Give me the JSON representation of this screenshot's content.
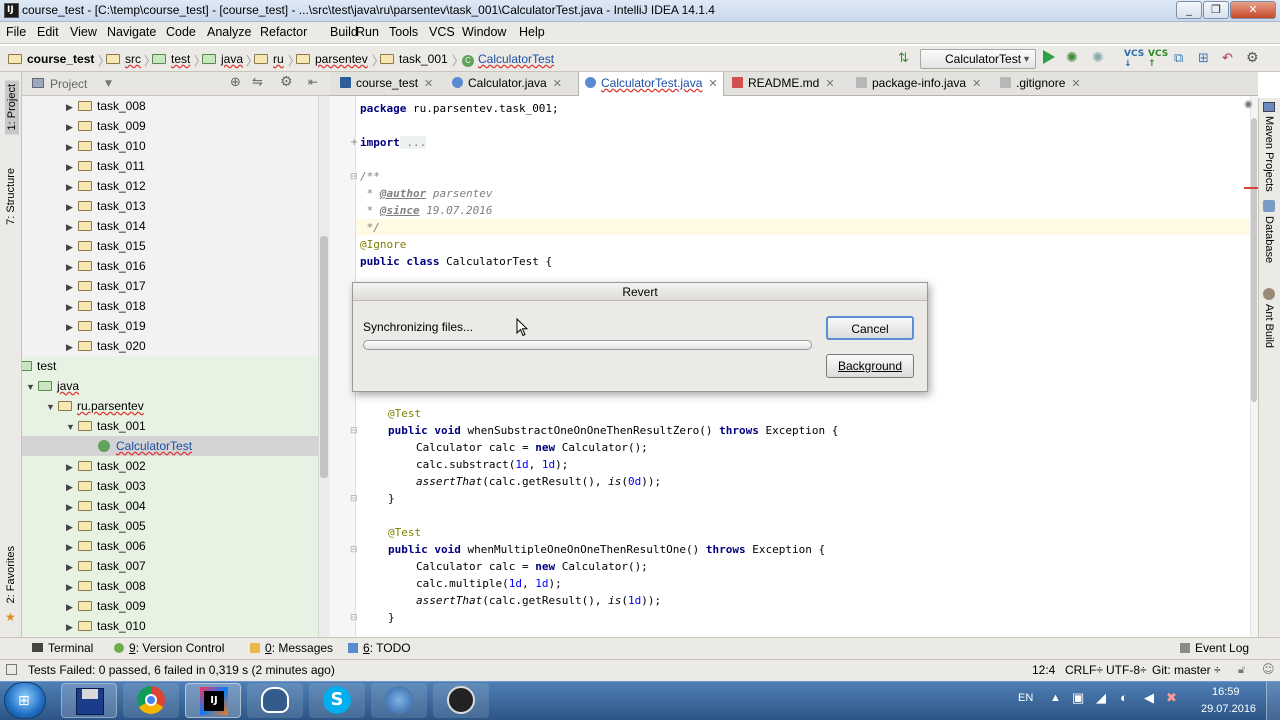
{
  "window": {
    "title": "course_test - [C:\\temp\\course_test] - [course_test] - ...\\src\\test\\java\\ru\\parsentev\\task_001\\CalculatorTest.java - IntelliJ IDEA 14.1.4",
    "app_icon": "intellij-icon"
  },
  "menu": [
    "File",
    "Edit",
    "View",
    "Navigate",
    "Code",
    "Analyze",
    "Refactor",
    "Build",
    "Run",
    "Tools",
    "VCS",
    "Window",
    "Help"
  ],
  "breadcrumb": [
    "course_test",
    "src",
    "test",
    "java",
    "ru",
    "parsentev",
    "task_001",
    "CalculatorTest"
  ],
  "run_config": "CalculatorTest",
  "left_tools": {
    "project": "1: Project",
    "structure": "7: Structure",
    "favorites": "2: Favorites"
  },
  "right_tools": {
    "maven": "Maven Projects",
    "database": "Database",
    "ant": "Ant Build"
  },
  "project_panel": {
    "title": "Project"
  },
  "tree": {
    "upper_tasks": [
      "task_008",
      "task_009",
      "task_010",
      "task_011",
      "task_012",
      "task_013",
      "task_014",
      "task_015",
      "task_016",
      "task_017",
      "task_018",
      "task_019",
      "task_020"
    ],
    "test_folder": "test",
    "java_folder": "java",
    "package": "ru.parsentev",
    "task_001": "task_001",
    "selected_file": "CalculatorTest",
    "lower_tasks": [
      "task_002",
      "task_003",
      "task_004",
      "task_005",
      "task_006",
      "task_007",
      "task_008",
      "task_009",
      "task_010"
    ]
  },
  "tabs": [
    {
      "label": "course_test",
      "active": false
    },
    {
      "label": "Calculator.java",
      "active": false
    },
    {
      "label": "CalculatorTest.java",
      "active": true
    },
    {
      "label": "README.md",
      "active": false
    },
    {
      "label": "package-info.java",
      "active": false
    },
    {
      "label": ".gitignore",
      "active": false
    }
  ],
  "code": {
    "package_kw": "package",
    "package_name": " ru.parsentev.task_001;",
    "import_kw": "import",
    "import_rest": " ...",
    "doc_open": "/**",
    "doc_author_star": " * ",
    "doc_author_tag": "@author",
    "doc_author_val": " parsentev",
    "doc_since_star": " * ",
    "doc_since_tag": "@since",
    "doc_since_val": " 19.07.2016",
    "doc_close": " */",
    "ignore": "@Ignore",
    "class_kw": "public class",
    "class_rest": " CalculatorTest {",
    "test1_ann": "@Test",
    "test1_kw": "public void",
    "test1_name": " whenSubstractOneOnOneThenResultZero()",
    "test1_throws": " throws",
    "test1_exc": " Exception {",
    "t1_l1_a": "Calculator calc = ",
    "t1_l1_kw": "new",
    "t1_l1_b": " Calculator();",
    "t1_l2_a": "calc.substract(",
    "t1_l2_n1": "1d",
    "t1_l2_c": ", ",
    "t1_l2_n2": "1d",
    "t1_l2_d": ");",
    "t1_l3_a": "assertThat",
    "t1_l3_b": "(calc.getResult(), ",
    "t1_l3_c": "is",
    "t1_l3_d": "(",
    "t1_l3_n": "0d",
    "t1_l3_e": "));",
    "close1": "}",
    "test2_ann": "@Test",
    "test2_kw": "public void",
    "test2_name": " whenMultipleOneOnOneThenResultOne()",
    "test2_throws": " throws",
    "test2_exc": " Exception {",
    "t2_l1_a": "Calculator calc = ",
    "t2_l1_kw": "new",
    "t2_l1_b": " Calculator();",
    "t2_l2_a": "calc.multiple(",
    "t2_l2_n1": "1d",
    "t2_l2_c": ", ",
    "t2_l2_n2": "1d",
    "t2_l2_d": ");",
    "t2_l3_a": "assertThat",
    "t2_l3_b": "(calc.getResult(), ",
    "t2_l3_c": "is",
    "t2_l3_d": "(",
    "t2_l3_n": "1d",
    "t2_l3_e": "));",
    "close2": "}"
  },
  "dialog": {
    "title": "Revert",
    "message": "Synchronizing files...",
    "progress": 0.0,
    "cancel": "Cancel",
    "background": "Background"
  },
  "bottom_tools": {
    "terminal": "Terminal",
    "vc_num": "9",
    "vc_label": ": Version Control",
    "msg_num": "0",
    "msg_label": ": Messages",
    "todo_num": "6",
    "todo_label": ": TODO",
    "event_log": "Event Log"
  },
  "status": {
    "message": "Tests Failed: 0 passed, 6 failed in 0,319 s (2 minutes ago)",
    "position": "12:4",
    "line_sep": "CRLF÷",
    "encoding": "UTF-8÷",
    "git": "Git: master ÷"
  },
  "taskbar": {
    "lang": "EN",
    "time": "16:59",
    "date": "29.07.2016"
  },
  "colors": {
    "keyword": "#000080",
    "annotation": "#808000",
    "comment": "#808080",
    "number": "#0000ff",
    "selection": "#d4d4d4",
    "taskbar": "#2c5586"
  }
}
